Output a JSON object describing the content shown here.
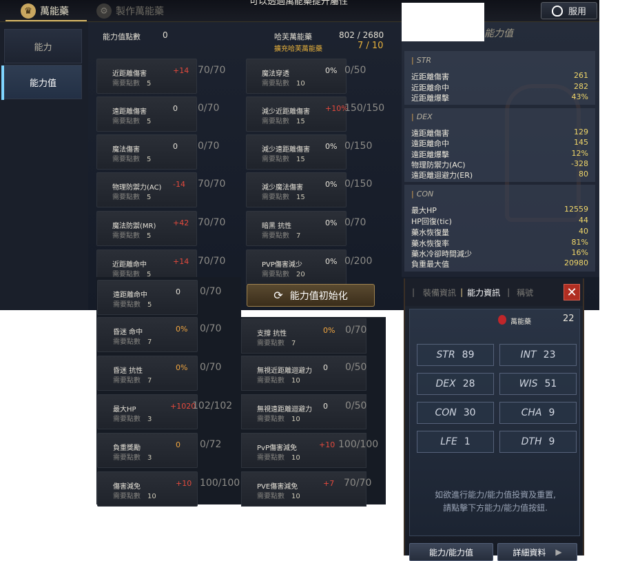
{
  "top_tabs": [
    {
      "label": "萬能藥",
      "active": true
    },
    {
      "label": "製作萬能藥",
      "active": false
    }
  ],
  "top_center_text": "可以透過萬能藥提升屬性",
  "service_button": "服用",
  "sidebar": [
    {
      "label": "能力"
    },
    {
      "label": "能力值"
    }
  ],
  "header": {
    "points_label": "能力值點數",
    "points_value": "0",
    "elixir_label": "哈芙萬能藥",
    "elixir_value": "802 / 2680",
    "expand_label": "擴充哈芙萬能藥",
    "expand_value": "7 / 10"
  },
  "col1": [
    {
      "name": "近距離傷害",
      "req_label": "需要點數",
      "req": "5",
      "bonus": "+14",
      "bonus_color": "red",
      "value": "70/70"
    },
    {
      "name": "遠距離傷害",
      "req_label": "需要點數",
      "req": "5",
      "bonus": "0",
      "bonus_color": "white",
      "value": "0/70"
    },
    {
      "name": "魔法傷害",
      "req_label": "需要點數",
      "req": "5",
      "bonus": "0",
      "bonus_color": "white",
      "value": "0/70"
    },
    {
      "name": "物理防禦力(AC)",
      "req_label": "需要點數",
      "req": "5",
      "bonus": "-14",
      "bonus_color": "red",
      "value": "70/70"
    },
    {
      "name": "魔法防禦(MR)",
      "req_label": "需要點數",
      "req": "5",
      "bonus": "+42",
      "bonus_color": "red",
      "value": "70/70"
    },
    {
      "name": "近距離命中",
      "req_label": "需要點數",
      "req": "5",
      "bonus": "+14",
      "bonus_color": "red",
      "value": "70/70"
    }
  ],
  "col2": [
    {
      "name": "魔法穿透",
      "req_label": "需要點數",
      "req": "10",
      "bonus": "0%",
      "bonus_color": "white",
      "value": "0/50"
    },
    {
      "name": "減少近距離傷害",
      "req_label": "需要點數",
      "req": "15",
      "bonus": "+10%",
      "bonus_color": "red",
      "value": "150/150"
    },
    {
      "name": "減少遠距離傷害",
      "req_label": "需要點數",
      "req": "15",
      "bonus": "0%",
      "bonus_color": "white",
      "value": "0/150"
    },
    {
      "name": "減少魔法傷害",
      "req_label": "需要點數",
      "req": "15",
      "bonus": "0%",
      "bonus_color": "white",
      "value": "0/150"
    },
    {
      "name": "暗黑 抗性",
      "req_label": "需要點數",
      "req": "7",
      "bonus": "0%",
      "bonus_color": "white",
      "value": "0/70"
    },
    {
      "name": "PVP傷害減少",
      "req_label": "需要點數",
      "req": "20",
      "bonus": "0%",
      "bonus_color": "white",
      "value": "0/200"
    }
  ],
  "lower_col1": [
    {
      "name": "遠距離命中",
      "req_label": "需要點數",
      "req": "5",
      "bonus": "0",
      "bonus_color": "white",
      "value": "0/70"
    },
    {
      "name": "昏迷 命中",
      "req_label": "需要點數",
      "req": "7",
      "bonus": "0%",
      "bonus_color": "orange",
      "value": "0/70"
    },
    {
      "name": "昏迷 抗性",
      "req_label": "需要點數",
      "req": "7",
      "bonus": "0%",
      "bonus_color": "orange",
      "value": "0/70"
    },
    {
      "name": "最大HP",
      "req_label": "需要點數",
      "req": "3",
      "bonus": "+1020",
      "bonus_color": "red",
      "value": "102/102"
    },
    {
      "name": "負重獎勵",
      "req_label": "需要點數",
      "req": "3",
      "bonus": "0",
      "bonus_color": "orange",
      "value": "0/72"
    },
    {
      "name": "傷害減免",
      "req_label": "需要點數",
      "req": "10",
      "bonus": "+10",
      "bonus_color": "red",
      "value": "100/100"
    }
  ],
  "lower_col2": [
    {
      "name": "支撐 抗性",
      "req_label": "需要點數",
      "req": "7",
      "bonus": "0%",
      "bonus_color": "orange",
      "value": "0/70"
    },
    {
      "name": "無視近距離迴避力",
      "req_label": "需要點數",
      "req": "10",
      "bonus": "0",
      "bonus_color": "white",
      "value": "0/50"
    },
    {
      "name": "無視遠距離迴避力",
      "req_label": "需要點數",
      "req": "10",
      "bonus": "0",
      "bonus_color": "white",
      "value": "0/50"
    },
    {
      "name": "PvP傷害減免",
      "req_label": "需要點數",
      "req": "10",
      "bonus": "+10",
      "bonus_color": "red",
      "value": "100/100"
    },
    {
      "name": "PVE傷害減免",
      "req_label": "需要點數",
      "req": "10",
      "bonus": "+7",
      "bonus_color": "red",
      "value": "70/70"
    }
  ],
  "reset_button": "能力值初始化",
  "stats_title": "能力值",
  "stats": {
    "str": {
      "head": "STR",
      "rows": [
        {
          "k": "近距離傷害",
          "v": "261"
        },
        {
          "k": "近距離命中",
          "v": "282"
        },
        {
          "k": "近距離爆擊",
          "v": "43%"
        }
      ]
    },
    "dex": {
      "head": "DEX",
      "rows": [
        {
          "k": "遠距離傷害",
          "v": "129"
        },
        {
          "k": "遠距離命中",
          "v": "145"
        },
        {
          "k": "遠距離爆擊",
          "v": "12%"
        },
        {
          "k": "物理防禦力(AC)",
          "v": "-328"
        },
        {
          "k": "遠距離迴避力(ER)",
          "v": "80"
        }
      ]
    },
    "con": {
      "head": "CON",
      "rows": [
        {
          "k": "最大HP",
          "v": "12559"
        },
        {
          "k": "HP回復(tic)",
          "v": "44"
        },
        {
          "k": "藥水恢復量",
          "v": "40"
        },
        {
          "k": "藥水恢復率",
          "v": "81%"
        },
        {
          "k": "藥水冷卻時間減少",
          "v": "16%"
        },
        {
          "k": "負重最大值",
          "v": "20980"
        }
      ]
    }
  },
  "char_panel": {
    "tabs": [
      "裝備資訊",
      "能力資訊",
      "稱號"
    ],
    "elixir_label": "萬能藥",
    "elixir_count": "22",
    "attrs": [
      {
        "k": "STR",
        "v": "89"
      },
      {
        "k": "INT",
        "v": "23"
      },
      {
        "k": "DEX",
        "v": "28"
      },
      {
        "k": "WIS",
        "v": "51"
      },
      {
        "k": "CON",
        "v": "30"
      },
      {
        "k": "CHA",
        "v": "9"
      },
      {
        "k": "LFE",
        "v": "1"
      },
      {
        "k": "DTH",
        "v": "9"
      }
    ],
    "hint_line1": "如欲進行能力/能力值投資及重置,",
    "hint_line2": "請點擊下方能力/能力值按鈕.",
    "btn_left": "能力/能力值",
    "btn_right": "詳細資料"
  }
}
